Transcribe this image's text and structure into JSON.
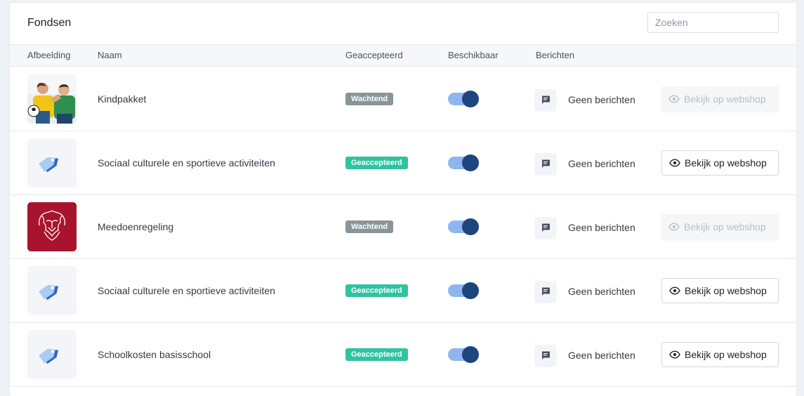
{
  "title": "Fondsen",
  "search": {
    "placeholder": "Zoeken"
  },
  "columns": [
    "Afbeelding",
    "Naam",
    "Geaccepteerd",
    "Beschikbaar",
    "Berichten"
  ],
  "colors": {
    "accepted": "#2fc3a0",
    "pending": "#8a9599",
    "toggle_knob": "#1d467f",
    "toggle_track": "#8fb5ef"
  },
  "rows": [
    {
      "image": "photo-children",
      "name": "Kindpakket",
      "status": "Wachtend",
      "available": true,
      "messages": "Geen berichten",
      "action": "Bekijk op webshop",
      "action_enabled": false
    },
    {
      "image": "tag-icon",
      "name": "Sociaal culturele en sportieve activiteiten",
      "status": "Geaccepteerd",
      "available": true,
      "messages": "Geen berichten",
      "action": "Bekijk op webshop",
      "action_enabled": true
    },
    {
      "image": "lion-emblem",
      "name": "Meedoenregeling",
      "status": "Wachtend",
      "available": true,
      "messages": "Geen berichten",
      "action": "Bekijk op webshop",
      "action_enabled": false
    },
    {
      "image": "tag-icon",
      "name": "Sociaal culturele en sportieve activiteiten",
      "status": "Geaccepteerd",
      "available": true,
      "messages": "Geen berichten",
      "action": "Bekijk op webshop",
      "action_enabled": true
    },
    {
      "image": "tag-icon",
      "name": "Schoolkosten basisschool",
      "status": "Geaccepteerd",
      "available": true,
      "messages": "Geen berichten",
      "action": "Bekijk op webshop",
      "action_enabled": true
    }
  ]
}
